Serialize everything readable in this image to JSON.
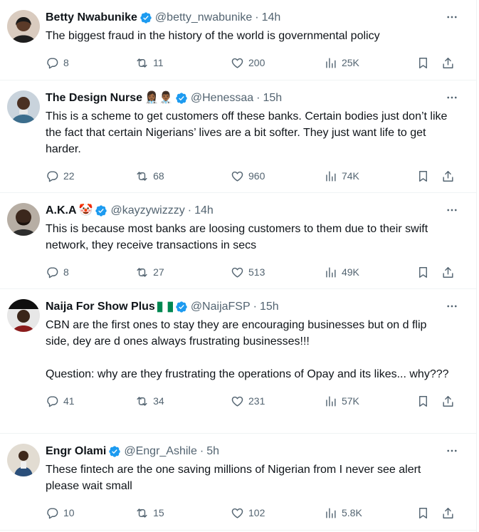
{
  "colors": {
    "verified": "#1d9bf0",
    "text": "#0f1419",
    "muted": "#536471",
    "divider": "#eff3f4"
  },
  "tweets": [
    {
      "name": "Betty Nwabunike",
      "emoji": "",
      "handle": "@betty_nwabunike",
      "time": "14h",
      "text": "The biggest fraud in the history of the world is governmental policy",
      "replies": "8",
      "reposts": "11",
      "likes": "200",
      "views": "25K"
    },
    {
      "name": "The Design Nurse",
      "emoji": "👩🏾‍⚕️👨🏾‍⚕️",
      "handle": "@Henessaa",
      "time": "15h",
      "text": "This is a scheme to get customers off these banks. Certain bodies just don’t like the fact that certain Nigerians’ lives are a bit softer. They just want life to get harder.",
      "replies": "22",
      "reposts": "68",
      "likes": "960",
      "views": "74K"
    },
    {
      "name": "A.K.A",
      "emoji": "🤡",
      "handle": "@kayzywizzzy",
      "time": "14h",
      "text": "This is because most banks are loosing customers to them due to their swift network, they receive transactions in secs",
      "replies": "8",
      "reposts": "27",
      "likes": "513",
      "views": "49K"
    },
    {
      "name": "Naija For Show Plus",
      "emoji": "🇳🇬",
      "handle": "@NaijaFSP",
      "time": "15h",
      "text": "CBN are the first ones to stay they are encouraging businesses but on d flip side, dey are d ones always frustrating businesses!!!\n\nQuestion: why are they frustrating the operations of Opay and its likes... why???",
      "replies": "41",
      "reposts": "34",
      "likes": "231",
      "views": "57K"
    },
    {
      "name": "Engr Olami",
      "emoji": "",
      "handle": "@Engr_Ashile",
      "time": "5h",
      "text": "These fintech are the one saving millions of Nigerian from I never see alert please wait small",
      "replies": "10",
      "reposts": "15",
      "likes": "102",
      "views": "5.8K"
    }
  ]
}
